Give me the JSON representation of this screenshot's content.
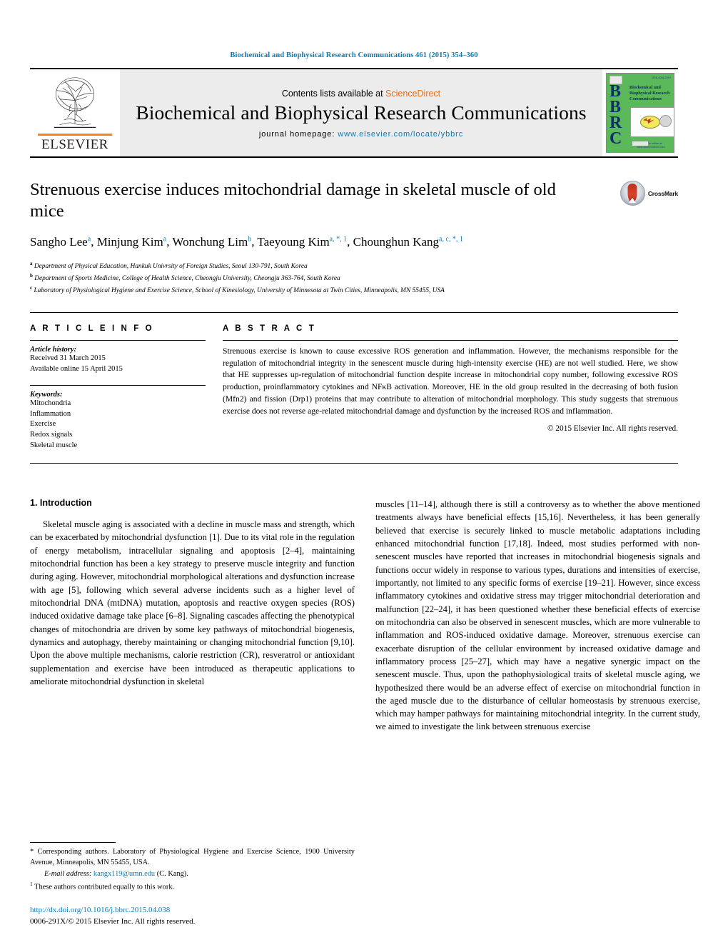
{
  "running_head": "Biochemical and Biophysical Research Communications 461 (2015) 354–360",
  "masthead": {
    "contents_prefix": "Contents lists available at ",
    "sciencedirect": "ScienceDirect",
    "journal_name": "Biochemical and Biophysical Research Communications",
    "homepage_prefix": "journal homepage: ",
    "homepage_url": "www.elsevier.com/locate/ybbrc",
    "publisher": "ELSEVIER",
    "cover": {
      "acronym": "BBRC",
      "title": "Biochemical and Biophysical Research Communications",
      "footer": "Available online at www.sciencedirect.com"
    },
    "accent_blue": "#0b7ab5",
    "accent_orange": "#ea6e1b",
    "cover_green": "#5bb85b"
  },
  "article": {
    "title": "Strenuous exercise induces mitochondrial damage in skeletal muscle of old mice",
    "crossmark_label": "CrossMark",
    "authors": [
      {
        "name": "Sangho Lee",
        "marks": "a",
        "sep": ", "
      },
      {
        "name": "Minjung Kim",
        "marks": "a",
        "sep": ", "
      },
      {
        "name": "Wonchung Lim",
        "marks": "b",
        "sep": ", "
      },
      {
        "name": "Taeyoung Kim",
        "marks": "a, *, 1",
        "sep": ", "
      },
      {
        "name": "Chounghun Kang",
        "marks": "a, c, *, 1",
        "sep": ""
      }
    ],
    "affiliations": [
      {
        "mark": "a",
        "text": "Department of Physical Education, Hankuk Univrsity of Foreign Studies, Seoul 130-791, South Korea"
      },
      {
        "mark": "b",
        "text": "Department of Sports Medicine, College of Health Science, Cheongju University, Cheongju 363-764, South Korea"
      },
      {
        "mark": "c",
        "text": "Laboratory of Physiological Hygiene and Exercise Science, School of Kinesiology, University of Minnesota at Twin Cities, Minneapolis, MN 55455, USA"
      }
    ]
  },
  "article_info": {
    "heading": "A R T I C L E  I N F O",
    "history_label": "Article history:",
    "history": [
      "Received 31 March 2015",
      "Available online 15 April 2015"
    ],
    "keywords_label": "Keywords:",
    "keywords": [
      "Mitochondria",
      "Inflammation",
      "Exercise",
      "Redox signals",
      "Skeletal muscle"
    ]
  },
  "abstract": {
    "heading": "A B S T R A C T",
    "body": "Strenuous exercise is known to cause excessive ROS generation and inflammation. However, the mechanisms responsible for the regulation of mitochondrial integrity in the senescent muscle during high-intensity exercise (HE) are not well studied. Here, we show that HE suppresses up-regulation of mitochondrial function despite increase in mitochondrial copy number, following excessive ROS production, proinflammatory cytokines and NFκB activation. Moreover, HE in the old group resulted in the decreasing of both fusion (Mfn2) and fission (Drp1) proteins that may contribute to alteration of mitochondrial morphology. This study suggests that strenuous exercise does not reverse age-related mitochondrial damage and dysfunction by the increased ROS and inflammation.",
    "copyright": "© 2015 Elsevier Inc. All rights reserved."
  },
  "body": {
    "intro_heading": "1. Introduction",
    "left_paragraph": "Skeletal muscle aging is associated with a decline in muscle mass and strength, which can be exacerbated by mitochondrial dysfunction [1]. Due to its vital role in the regulation of energy metabolism, intracellular signaling and apoptosis [2–4], maintaining mitochondrial function has been a key strategy to preserve muscle integrity and function during aging. However, mitochondrial morphological alterations and dysfunction increase with age [5], following which several adverse incidents such as a higher level of mitochondrial DNA (mtDNA) mutation, apoptosis and reactive oxygen species (ROS) induced oxidative damage take place [6–8]. Signaling cascades affecting the phenotypical changes of mitochondria are driven by some key pathways of mitochondrial biogenesis, dynamics and autophagy, thereby maintaining or changing mitochondrial function [9,10]. Upon the above multiple mechanisms, calorie restriction (CR), resveratrol or antioxidant supplementation and exercise have been introduced as therapeutic applications to ameliorate mitochondrial dysfunction in skeletal",
    "right_paragraph": "muscles [11–14], although there is still a controversy as to whether the above mentioned treatments always have beneficial effects [15,16]. Nevertheless, it has been generally believed that exercise is securely linked to muscle metabolic adaptations including enhanced mitochondrial function [17,18]. Indeed, most studies performed with non-senescent muscles have reported that increases in mitochondrial biogenesis signals and functions occur widely in response to various types, durations and intensities of exercise, importantly, not limited to any specific forms of exercise [19–21]. However, since excess inflammatory cytokines and oxidative stress may trigger mitochondrial deterioration and malfunction [22–24], it has been questioned whether these beneficial effects of exercise on mitochondria can also be observed in senescent muscles, which are more vulnerable to inflammation and ROS-induced oxidative damage. Moreover, strenuous exercise can exacerbate disruption of the cellular environment by increased oxidative damage and inflammatory process [25–27], which may have a negative synergic impact on the senescent muscle. Thus, upon the pathophysiological traits of skeletal muscle aging, we hypothesized there would be an adverse effect of exercise on mitochondrial function in the aged muscle due to the disturbance of cellular homeostasis by strenuous exercise, which may hamper pathways for maintaining mitochondrial integrity. In the current study, we aimed to investigate the link between strenuous exercise"
  },
  "footnotes": {
    "corresponding": "Corresponding authors. Laboratory of Physiological Hygiene and Exercise Science, 1900 University Avenue, Minneapolis, MN 55455, USA.",
    "email_label": "E-mail address:",
    "email": "kangx119@umn.edu",
    "email_suffix": "(C. Kang).",
    "equal_contrib": "These authors contributed equally to this work.",
    "doi": "http://dx.doi.org/10.1016/j.bbrc.2015.04.038",
    "issn_line": "0006-291X/© 2015 Elsevier Inc. All rights reserved."
  }
}
